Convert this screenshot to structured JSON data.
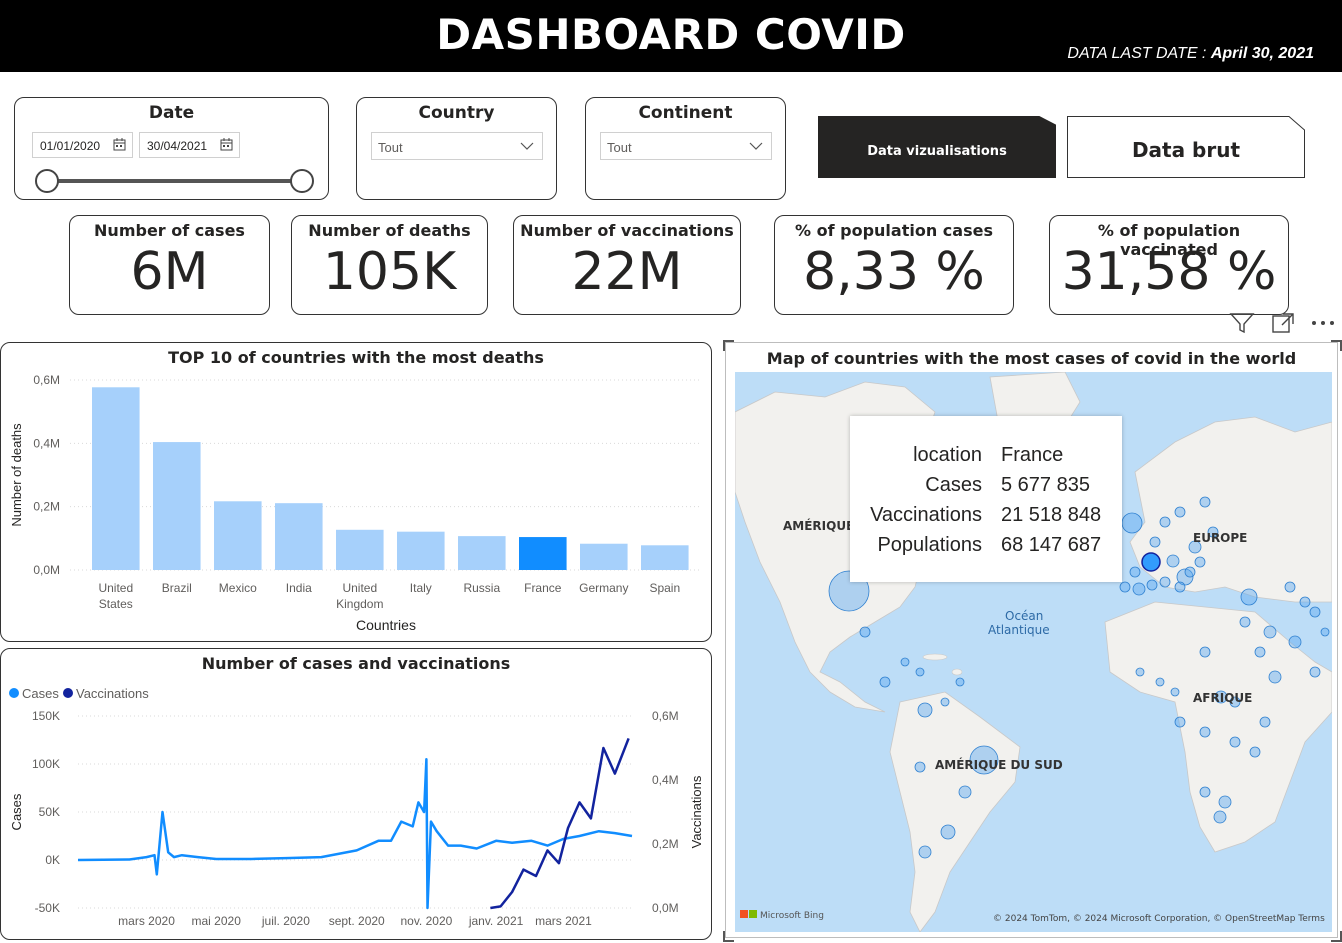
{
  "header": {
    "title": "DASHBOARD COVID",
    "last_date_label": "DATA LAST DATE :",
    "last_date_value": "April 30, 2021"
  },
  "slicers": {
    "date": {
      "title": "Date",
      "start": "01/01/2020",
      "end": "30/04/2021"
    },
    "country": {
      "title": "Country",
      "value": "Tout"
    },
    "continent": {
      "title": "Continent",
      "value": "Tout"
    }
  },
  "nav": {
    "viz_label": "Data vizualisations",
    "brut_label": "Data brut"
  },
  "kpis": [
    {
      "label": "Number of cases",
      "value": "6M"
    },
    {
      "label": "Number of deaths",
      "value": "105K"
    },
    {
      "label": "Number of vaccinations",
      "value": "22M"
    },
    {
      "label": "% of population cases",
      "value": "8,33 %"
    },
    {
      "label": "% of population vaccinated",
      "value": "31,58 %"
    }
  ],
  "bar_visual": {
    "title": "TOP 10 of countries with the most deaths",
    "xlabel": "Countries",
    "ylabel": "Number of deaths"
  },
  "line_visual": {
    "title": "Number of cases and vaccinations",
    "legend_cases": "Cases",
    "legend_vacc": "Vaccinations",
    "ylabel_left": "Cases",
    "ylabel_right": "Vaccinations"
  },
  "map_visual": {
    "title": "Map of countries with the most cases of covid in the world",
    "labels": {
      "amerique": "AMÉRIQUE",
      "europe": "EUROPE",
      "ocean1": "Océan",
      "ocean2": "Atlantique",
      "afrique": "AFRIQUE",
      "amerique_sud": "AMÉRIQUE DU SUD"
    },
    "bing": "Microsoft Bing",
    "copyright": "© 2024 TomTom, © 2024 Microsoft Corporation, © OpenStreetMap  Terms",
    "tooltip": [
      {
        "k": "location",
        "v": "France"
      },
      {
        "k": "Cases",
        "v": "5 677 835"
      },
      {
        "k": "Vaccinations",
        "v": "21 518 848"
      },
      {
        "k": "Populations",
        "v": "68 147 687"
      }
    ]
  },
  "colors": {
    "bar": "#a6d0fb",
    "bar_highlight": "#118dff",
    "cases": "#118dff",
    "vaccinations": "#12239e",
    "map_water": "#bdddf7",
    "map_land": "#f2f1ee"
  },
  "chart_data": [
    {
      "type": "bar",
      "title": "TOP 10 of countries with the most deaths",
      "xlabel": "Countries",
      "ylabel": "Number of deaths",
      "categories": [
        "United States",
        "Brazil",
        "Mexico",
        "India",
        "United Kingdom",
        "Italy",
        "Russia",
        "France",
        "Germany",
        "Spain"
      ],
      "values": [
        577000,
        404000,
        217000,
        211000,
        127000,
        121000,
        107000,
        104000,
        83000,
        78000
      ],
      "highlight": "France",
      "yticks": [
        "0,0M",
        "0,2M",
        "0,4M",
        "0,6M"
      ],
      "ylim": [
        0,
        600000
      ],
      "grid": true
    },
    {
      "type": "line",
      "title": "Number of cases and vaccinations",
      "xticks": [
        "mars 2020",
        "mai 2020",
        "juil. 2020",
        "sept. 2020",
        "nov. 2020",
        "janv. 2021",
        "mars 2021"
      ],
      "yticks_left": [
        "-50K",
        "0K",
        "50K",
        "100K",
        "150K"
      ],
      "yticks_right": [
        "0,0M",
        "0,2M",
        "0,4M",
        "0,6M"
      ],
      "ylim_left": [
        -50000,
        150000
      ],
      "ylim_right": [
        0,
        600000
      ],
      "series": [
        {
          "name": "Cases",
          "axis": "left",
          "x": [
            "2020-01-01",
            "2020-02-15",
            "2020-03-01",
            "2020-03-08",
            "2020-03-10",
            "2020-03-15",
            "2020-03-20",
            "2020-03-25",
            "2020-04-01",
            "2020-04-15",
            "2020-05-01",
            "2020-06-01",
            "2020-07-01",
            "2020-08-01",
            "2020-09-01",
            "2020-09-20",
            "2020-10-01",
            "2020-10-10",
            "2020-10-20",
            "2020-10-25",
            "2020-10-30",
            "2020-11-01",
            "2020-11-02",
            "2020-11-05",
            "2020-11-10",
            "2020-11-20",
            "2020-12-01",
            "2020-12-15",
            "2021-01-01",
            "2021-01-15",
            "2021-02-01",
            "2021-02-15",
            "2021-03-01",
            "2021-03-15",
            "2021-04-01",
            "2021-04-15",
            "2021-04-30"
          ],
          "y": [
            0,
            500,
            3000,
            5000,
            -15000,
            50000,
            8000,
            3000,
            5000,
            3000,
            1000,
            1000,
            2000,
            3000,
            10000,
            20000,
            20000,
            40000,
            35000,
            60000,
            50000,
            105000,
            -50000,
            40000,
            30000,
            15000,
            15000,
            12000,
            20000,
            18000,
            20000,
            15000,
            22000,
            25000,
            30000,
            28000,
            25000
          ]
        },
        {
          "name": "Vaccinations",
          "axis": "right",
          "x": [
            "2020-12-27",
            "2021-01-05",
            "2021-01-15",
            "2021-01-25",
            "2021-02-05",
            "2021-02-15",
            "2021-02-25",
            "2021-03-05",
            "2021-03-15",
            "2021-03-25",
            "2021-04-05",
            "2021-04-15",
            "2021-04-27"
          ],
          "y": [
            0,
            5000,
            50000,
            120000,
            100000,
            180000,
            140000,
            250000,
            330000,
            280000,
            500000,
            420000,
            530000
          ]
        }
      ]
    }
  ]
}
